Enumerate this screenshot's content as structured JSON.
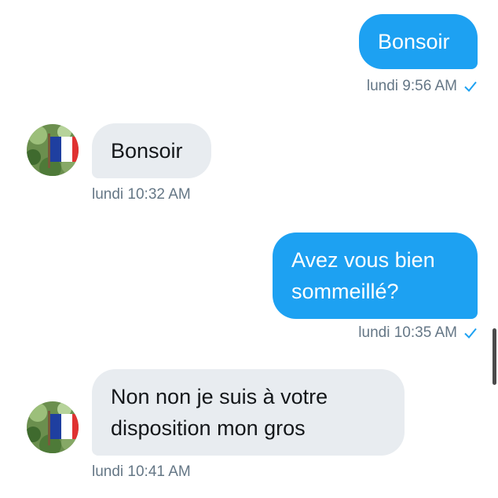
{
  "messages": [
    {
      "direction": "out",
      "text": "Bonsoir",
      "timestamp": "lundi 9:56 AM",
      "read_icon": "check-icon"
    },
    {
      "direction": "in",
      "text": "Bonsoir",
      "timestamp": "lundi 10:32 AM"
    },
    {
      "direction": "out",
      "text": "Avez vous bien\nsommeillé?",
      "timestamp": "lundi 10:35 AM",
      "read_icon": "check-icon"
    },
    {
      "direction": "in",
      "text": "Non non  je  suis  à votre\ndisposition mon gros",
      "timestamp": "lundi 10:41 AM"
    }
  ],
  "colors": {
    "outgoing_bubble": "#1da1f2",
    "incoming_bubble": "#e8ecf0",
    "timestamp_text": "#657786",
    "check": "#1da1f2"
  },
  "avatar": {
    "icon": "french-flag-avatar-icon"
  }
}
